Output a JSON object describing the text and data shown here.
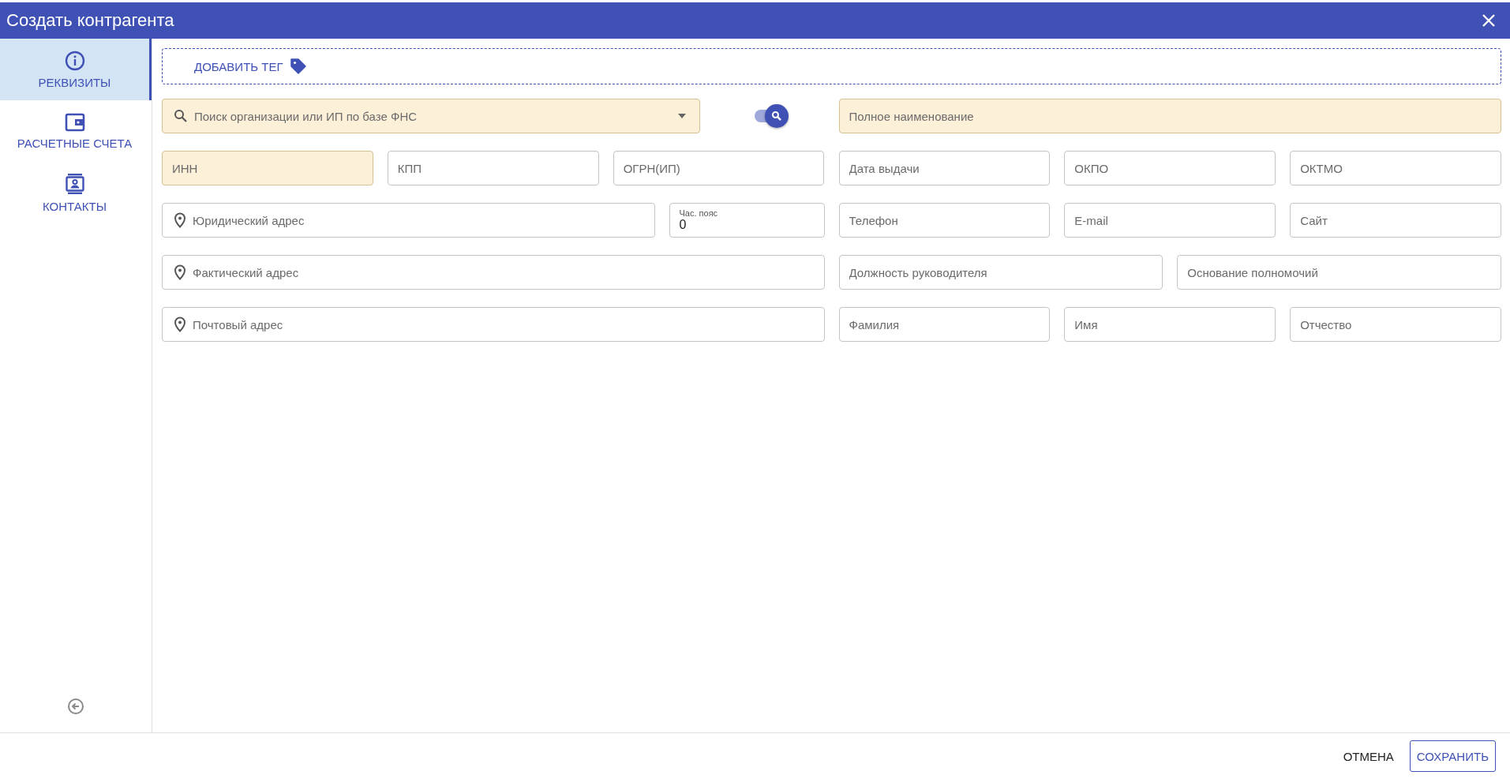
{
  "window": {
    "title": "Создать контрагента"
  },
  "sidebar": {
    "items": [
      {
        "label": "РЕКВИЗИТЫ",
        "selected": true
      },
      {
        "label": "РАСЧЕТНЫЕ СЧЕТА",
        "selected": false
      },
      {
        "label": "КОНТАКТЫ",
        "selected": false
      }
    ]
  },
  "tag_button": {
    "label": "ДОБАВИТЬ ТЕГ"
  },
  "org_search": {
    "placeholder": "Поиск организации или ИП по базе ФНС",
    "required": true
  },
  "fns_toggle": {
    "on": true
  },
  "full_name": {
    "placeholder": "Полное наименование",
    "required": true
  },
  "rows": [
    {
      "left": [
        {
          "kind": "text",
          "placeholder": "ИНН",
          "required": true
        },
        {
          "kind": "text",
          "placeholder": "КПП",
          "required": false
        },
        {
          "kind": "text",
          "placeholder": "ОГРН(ИП)",
          "required": false
        }
      ],
      "right": [
        {
          "kind": "text",
          "placeholder": "Дата выдачи",
          "required": false
        },
        {
          "kind": "text",
          "placeholder": "ОКПО",
          "required": false
        },
        {
          "kind": "text",
          "placeholder": "ОКТМО",
          "required": false
        }
      ]
    },
    {
      "left": [
        {
          "kind": "address",
          "placeholder": "Юридический адрес",
          "required": false
        },
        {
          "kind": "labeled",
          "label": "Час. пояс",
          "value": "0",
          "required": false
        }
      ],
      "right": [
        {
          "kind": "text",
          "placeholder": "Телефон",
          "required": false
        },
        {
          "kind": "text",
          "placeholder": "E-mail",
          "required": false
        },
        {
          "kind": "text",
          "placeholder": "Сайт",
          "required": false
        }
      ]
    },
    {
      "left": [
        {
          "kind": "address",
          "placeholder": "Фактический адрес",
          "required": false
        }
      ],
      "right": [
        {
          "kind": "text",
          "placeholder": "Должность руководителя",
          "required": false
        },
        {
          "kind": "text",
          "placeholder": "Основание полномочий",
          "required": false
        }
      ]
    },
    {
      "left": [
        {
          "kind": "address",
          "placeholder": "Почтовый адрес",
          "required": false
        }
      ],
      "right": [
        {
          "kind": "text",
          "placeholder": "Фамилия",
          "required": false
        },
        {
          "kind": "text",
          "placeholder": "Имя",
          "required": false
        },
        {
          "kind": "text",
          "placeholder": "Отчество",
          "required": false
        }
      ]
    }
  ],
  "footer": {
    "cancel": "ОТМЕНА",
    "save": "СОХРАНИТЬ"
  }
}
